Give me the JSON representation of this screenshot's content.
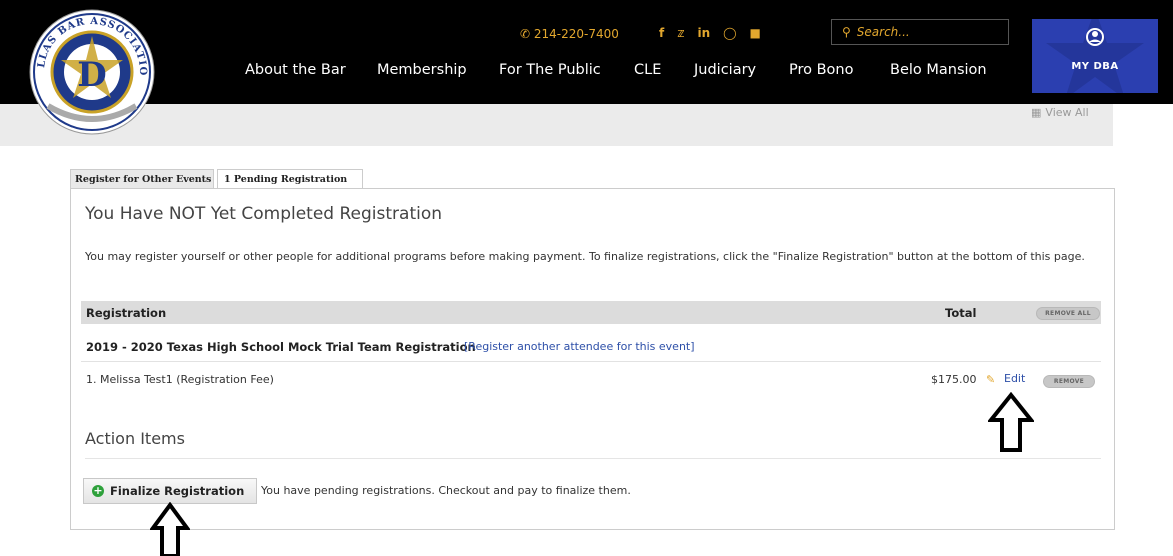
{
  "header": {
    "phone": "214-220-7400",
    "search_placeholder": "Search...",
    "nav": [
      {
        "label": "About the Bar"
      },
      {
        "label": "Membership"
      },
      {
        "label": "For The Public"
      },
      {
        "label": "CLE"
      },
      {
        "label": "Judiciary"
      },
      {
        "label": "Pro Bono"
      },
      {
        "label": "Belo Mansion"
      }
    ],
    "my_dba": "MY DBA",
    "logo_text": "DALLAS BAR ASSOCIATION",
    "logo_letter": "D",
    "view_all": "View All",
    "social": [
      "facebook-icon",
      "twitter-icon",
      "linkedin-icon",
      "instagram-icon",
      "flickr-icon"
    ],
    "accent": "#e2a72e",
    "brand_blue": "#2b3fb0"
  },
  "tabs": [
    {
      "label": "Register for Other Events"
    },
    {
      "label": "1 Pending Registration"
    }
  ],
  "main": {
    "title": "You Have NOT Yet Completed Registration",
    "intro": "You may register yourself or other people for additional programs before making payment. To finalize registrations, click the \"Finalize Registration\" button at the bottom of this page.",
    "table": {
      "col_registration": "Registration",
      "col_total": "Total",
      "remove_all": "REMOVE ALL"
    },
    "event": {
      "name": "2019 - 2020 Texas High School Mock Trial Team Registration",
      "link": "[Register another attendee for this event]"
    },
    "attendee": {
      "line": "1. Melissa Test1   (Registration Fee)",
      "amount": "$175.00",
      "edit": "Edit",
      "remove": "REMOVE"
    },
    "action_items": "Action Items",
    "finalize_button": "Finalize Registration",
    "pending_message": "You have pending registrations. Checkout and pay to finalize them."
  }
}
